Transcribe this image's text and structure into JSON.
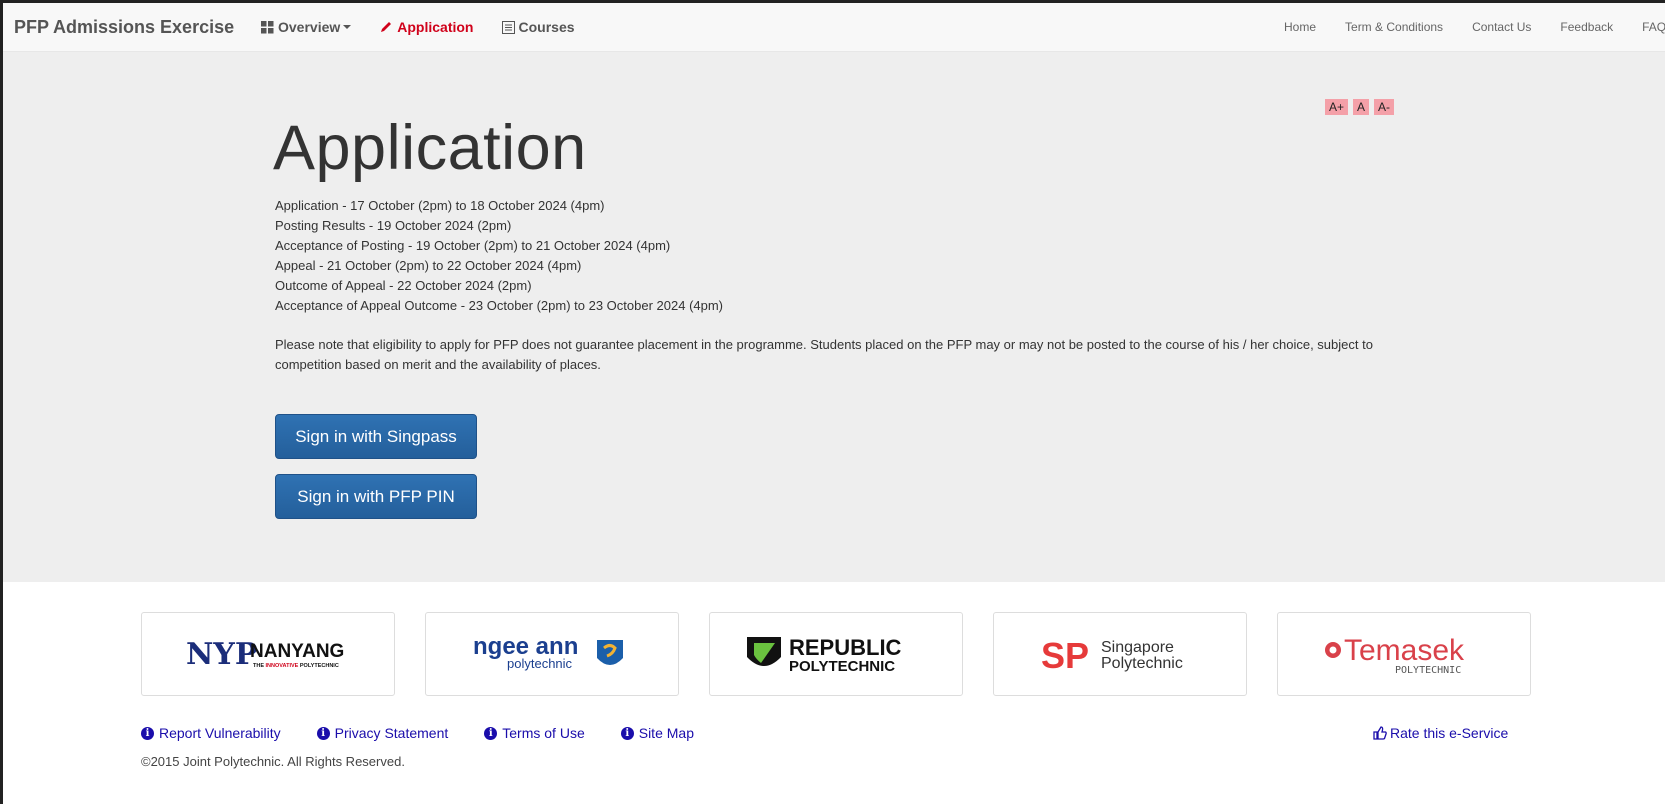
{
  "navbar": {
    "brand": "PFP Admissions Exercise",
    "items": [
      {
        "label": "Overview",
        "icon": "grid-icon",
        "dropdown": true
      },
      {
        "label": "Application",
        "icon": "pencil-icon",
        "active": true
      },
      {
        "label": "Courses",
        "icon": "list-icon"
      }
    ],
    "right_links": [
      "Home",
      "Term & Conditions",
      "Contact Us",
      "Feedback",
      "FAQs"
    ]
  },
  "font_sizer": {
    "increase": "A+",
    "normal": "A",
    "decrease": "A-"
  },
  "main": {
    "title": "Application",
    "schedule": [
      "Application - 17 October (2pm) to 18 October 2024 (4pm)",
      "Posting Results - 19 October 2024 (2pm)",
      "Acceptance of Posting - 19 October (2pm) to 21 October 2024 (4pm)",
      "Appeal - 21 October (2pm) to 22 October 2024 (4pm)",
      "Outcome of Appeal - 22 October 2024 (2pm)",
      "Acceptance of Appeal Outcome - 23 October (2pm) to 23 October 2024 (4pm)"
    ],
    "note": "Please note that eligibility to apply for PFP does not guarantee placement in the programme. Students placed on the PFP may or may not be posted to the course of his / her choice, subject to competition based on merit and the availability of places.",
    "singpass_button": "Sign in with Singpass",
    "pin_button": "Sign in with PFP PIN"
  },
  "logos": {
    "nyp": {
      "mark": "NYP",
      "name": "NANYANG",
      "tagline_pre": "THE ",
      "tagline_em": "INNOVATIVE",
      "tagline_post": " POLYTECHNIC"
    },
    "np": {
      "name": "ngee ann",
      "sub": "polytechnic"
    },
    "rp": {
      "name": "REPUBLIC",
      "sub": "POLYTECHNIC"
    },
    "sp": {
      "mark": "SP",
      "name": "Singapore",
      "sub": "Polytechnic"
    },
    "tp": {
      "name": "Temasek",
      "sub": "POLYTECHNIC"
    }
  },
  "footer": {
    "links": [
      "Report Vulnerability",
      "Privacy Statement",
      "Terms of Use",
      "Site Map"
    ],
    "rate": "Rate this e-Service",
    "copyright": "©2015 Joint Polytechnic. All Rights Reserved."
  },
  "colors": {
    "active_nav": "#d0021b",
    "button": "#2a6aa8",
    "link": "#1a0dab",
    "font_sizer_bg": "#f4a0a8"
  }
}
